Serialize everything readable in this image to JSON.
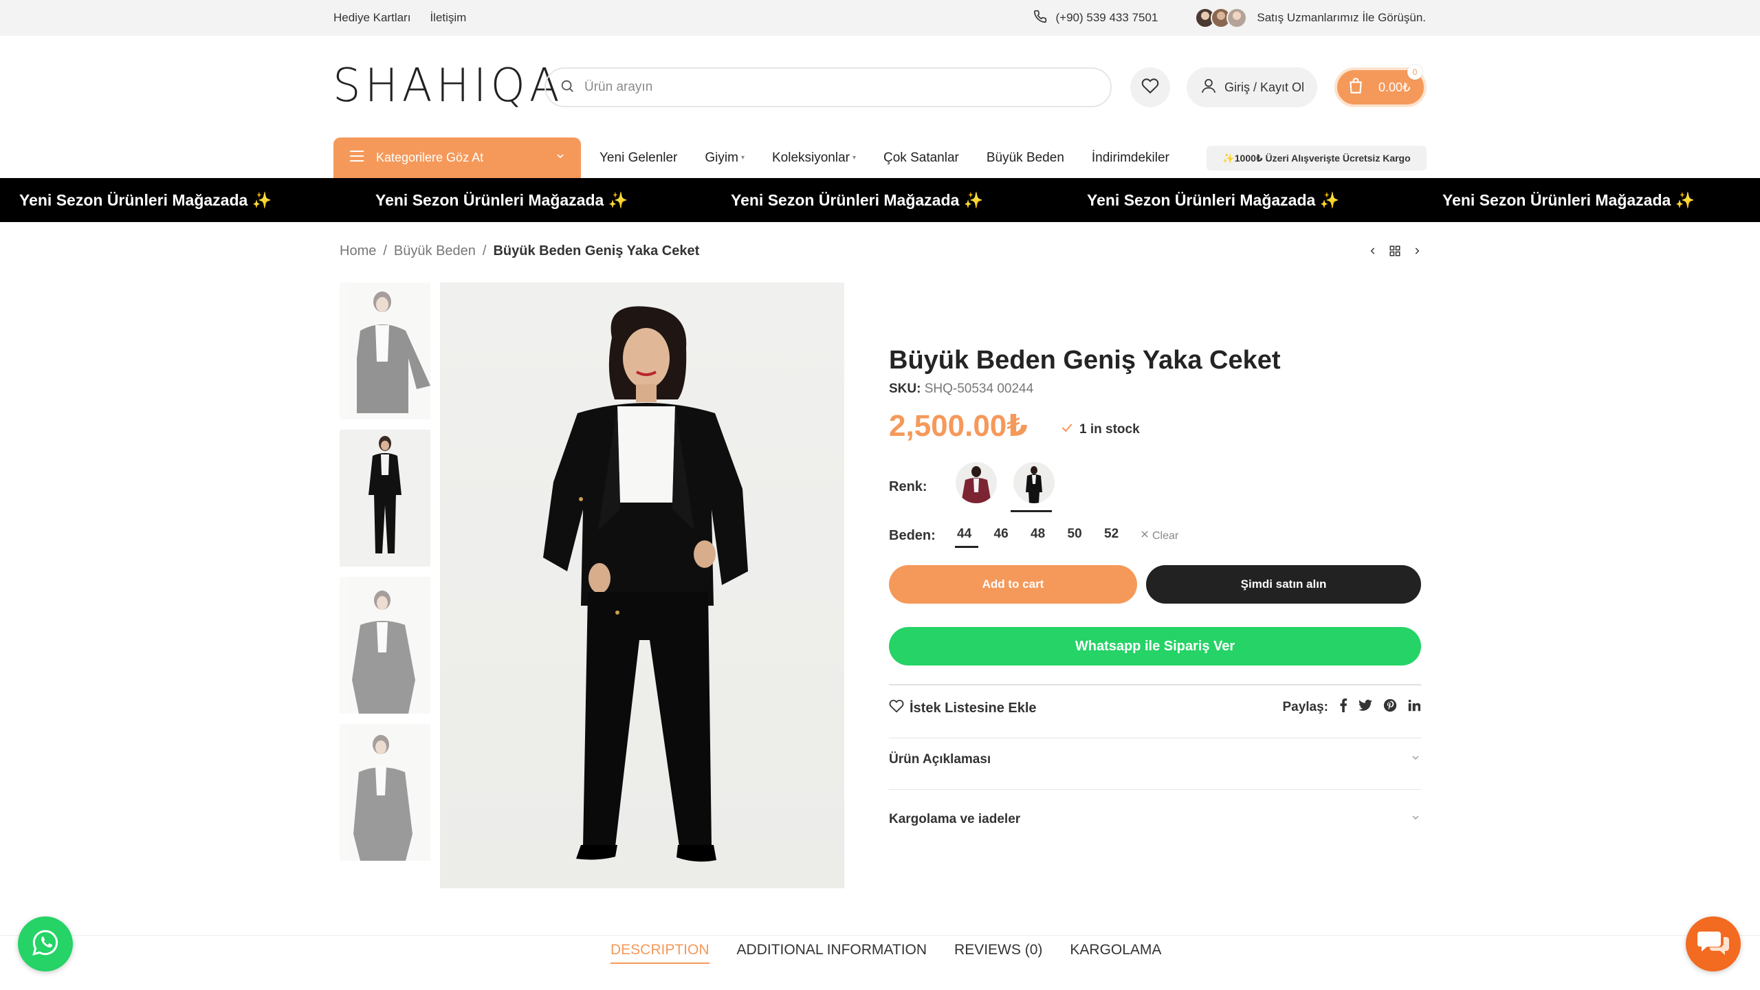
{
  "topbar": {
    "links": [
      "Hediye Kartları",
      "İletişim"
    ],
    "phone": "(+90) 539 433 7501",
    "experts_text": "Satış Uzmanlarımız İle Görüşün."
  },
  "header": {
    "logo": "SHAHIQA",
    "search_placeholder": "Ürün arayın",
    "login_label": "Giriş / Kayıt Ol",
    "cart_total": "0.00₺",
    "cart_count": "0"
  },
  "nav": {
    "categories_label": "Kategorilere Göz At",
    "items": [
      "Yeni Gelenler",
      "Giyim",
      "Koleksiyonlar",
      "Çok Satanlar",
      "Büyük Beden",
      "İndirimdekiler"
    ],
    "promo": "✨1000₺ Üzeri Alışverişte Ücretsiz Kargo"
  },
  "marquee": {
    "text": "Yeni Sezon Ürünleri Mağazada ✨"
  },
  "breadcrumb": {
    "items": [
      "Home",
      "Büyük Beden"
    ],
    "current": "Büyük Beden Geniş Yaka Ceket"
  },
  "product": {
    "title": "Büyük Beden Geniş Yaka Ceket",
    "sku_label": "SKU:",
    "sku": "SHQ-50534 00244",
    "price": "2,500.00₺",
    "stock": "1 in stock",
    "color_label": "Renk",
    "colors": [
      "bordo",
      "siyah"
    ],
    "size_label": "Beden",
    "sizes": [
      "44",
      "46",
      "48",
      "50",
      "52"
    ],
    "selected_size": "44",
    "clear_label": "Clear",
    "add_to_cart": "Add to cart",
    "buy_now": "Şimdi satın alın",
    "whatsapp_order": "Whatsapp ile Sipariş Ver",
    "wishlist": "İstek Listesine Ekle",
    "share_label": "Paylaş:",
    "accordions": [
      "Ürün Açıklaması",
      "Kargolama ve iadeler"
    ]
  },
  "tabs": {
    "items": [
      "DESCRIPTION",
      "ADDITIONAL INFORMATION",
      "REVIEWS (0)",
      "KARGOLAMA"
    ],
    "active": "DESCRIPTION"
  },
  "colors": {
    "accent": "#f5995a",
    "dark": "#222222",
    "whatsapp": "#25d366",
    "chat": "#f26b21"
  }
}
